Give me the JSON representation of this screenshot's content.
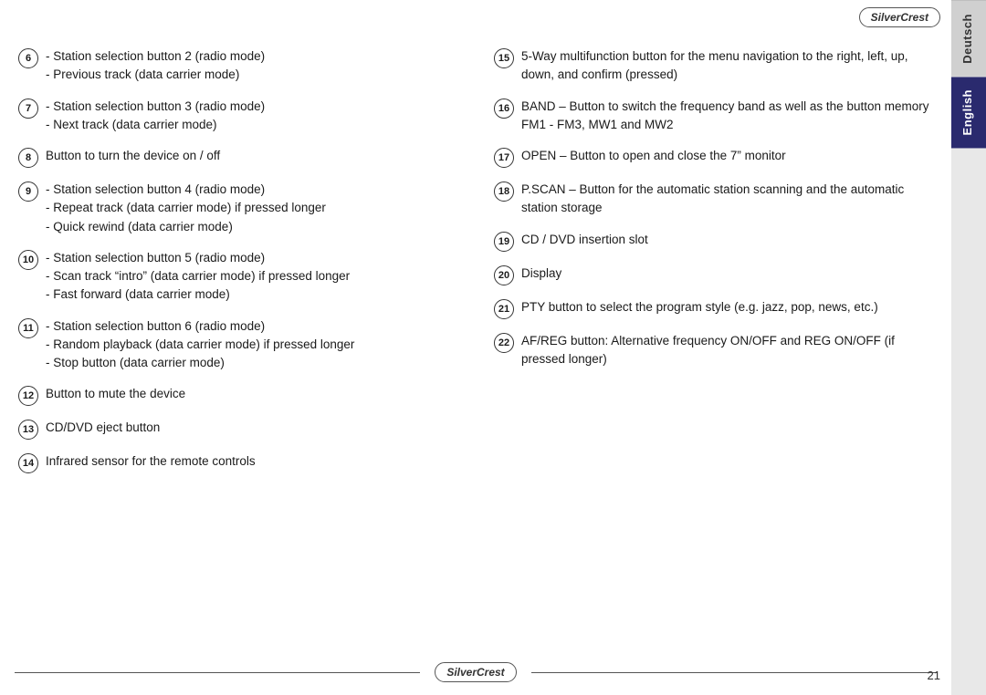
{
  "logo": "SilverCrest",
  "page_number": "21",
  "sidebar": {
    "tabs": [
      {
        "id": "deutsch",
        "label": "Deutsch"
      },
      {
        "id": "english",
        "label": "English"
      }
    ]
  },
  "left_column": {
    "items": [
      {
        "number": "6",
        "text": "- Station selection button 2 (radio mode)\n- Previous track (data carrier mode)"
      },
      {
        "number": "7",
        "text": "- Station selection button 3 (radio mode)\n- Next track (data carrier mode)"
      },
      {
        "number": "8",
        "text": "Button to turn the device on / off"
      },
      {
        "number": "9",
        "text": "- Station selection button 4 (radio mode)\n- Repeat track (data carrier mode) if pressed longer\n- Quick rewind (data carrier mode)"
      },
      {
        "number": "10",
        "text": "- Station selection button 5 (radio mode)\n- Scan track “intro” (data carrier mode) if pressed longer\n- Fast forward (data carrier mode)"
      },
      {
        "number": "11",
        "text": "- Station selection button 6 (radio mode)\n- Random playback (data carrier mode) if pressed longer\n- Stop button (data carrier mode)"
      },
      {
        "number": "12",
        "text": "Button to mute the device"
      },
      {
        "number": "13",
        "text": "CD/DVD eject button"
      },
      {
        "number": "14",
        "text": "Infrared sensor for the remote controls"
      }
    ]
  },
  "right_column": {
    "items": [
      {
        "number": "15",
        "text": "5-Way multifunction button for the menu navigation to the right, left, up, down, and confirm (pressed)"
      },
      {
        "number": "16",
        "text": "BAND – Button to switch the frequency band as well as the button memory FM1 - FM3, MW1 and MW2"
      },
      {
        "number": "17",
        "text": "OPEN – Button to open and close the 7” monitor"
      },
      {
        "number": "18",
        "text": "P.SCAN – Button for the automatic station scanning and the automatic station storage"
      },
      {
        "number": "19",
        "text": "CD / DVD insertion slot"
      },
      {
        "number": "20",
        "text": "Display"
      },
      {
        "number": "21",
        "text": "PTY button to select the program style (e.g. jazz, pop, news, etc.)"
      },
      {
        "number": "22",
        "text": "AF/REG button: Alternative frequency ON/OFF and REG ON/OFF (if pressed longer)"
      }
    ]
  }
}
